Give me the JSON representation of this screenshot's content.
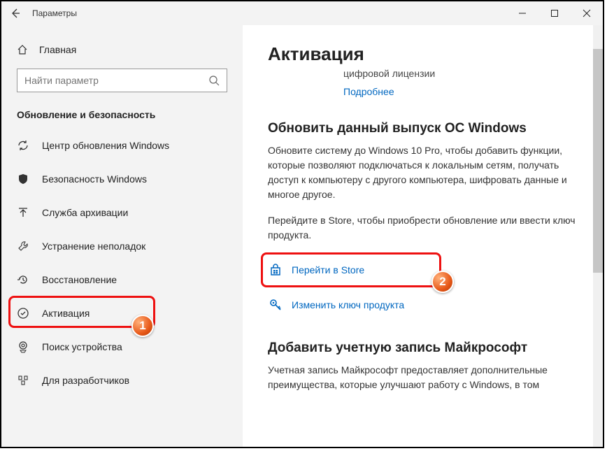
{
  "titlebar": {
    "app_title": "Параметры"
  },
  "sidebar": {
    "home_label": "Главная",
    "search_placeholder": "Найти параметр",
    "section_title": "Обновление и безопасность",
    "items": [
      {
        "label": "Центр обновления Windows"
      },
      {
        "label": "Безопасность Windows"
      },
      {
        "label": "Служба архивации"
      },
      {
        "label": "Устранение неполадок"
      },
      {
        "label": "Восстановление"
      },
      {
        "label": "Активация"
      },
      {
        "label": "Поиск устройства"
      },
      {
        "label": "Для разработчиков"
      }
    ]
  },
  "content": {
    "title": "Активация",
    "license_text": "цифровой лицензии",
    "more_link": "Подробнее",
    "upgrade": {
      "heading": "Обновить данный выпуск ОС Windows",
      "para1": "Обновите систему до Windows 10 Pro, чтобы добавить функции, которые позволяют подключаться к локальным сетям, получать доступ к компьютеру с другого компьютера, шифровать данные и многое другое.",
      "para2": "Перейдите в Store, чтобы приобрести обновление или ввести ключ продукта.",
      "store_label": "Перейти в Store",
      "change_key_label": "Изменить ключ продукта"
    },
    "ms_account": {
      "heading": "Добавить учетную запись Майкрософт",
      "para": "Учетная запись Майкрософт предоставляет дополнительные преимущества, которые улучшают работу с Windows, в том"
    }
  },
  "annotations": {
    "badge1": "1",
    "badge2": "2"
  }
}
